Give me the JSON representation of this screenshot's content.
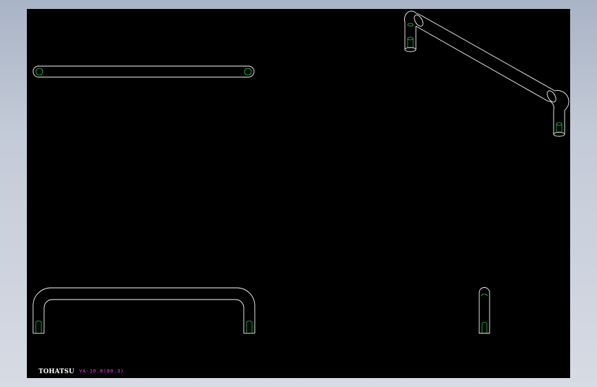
{
  "drawing": {
    "brand_text": "TOHATSU",
    "part_number": "VA-10.8(80.3)",
    "colors": {
      "sheet": "#000000",
      "outline": "#ffffff",
      "hidden_detail": "#22cc44",
      "annotation": "#ff33ff",
      "frame": "#b7c0cf"
    }
  }
}
